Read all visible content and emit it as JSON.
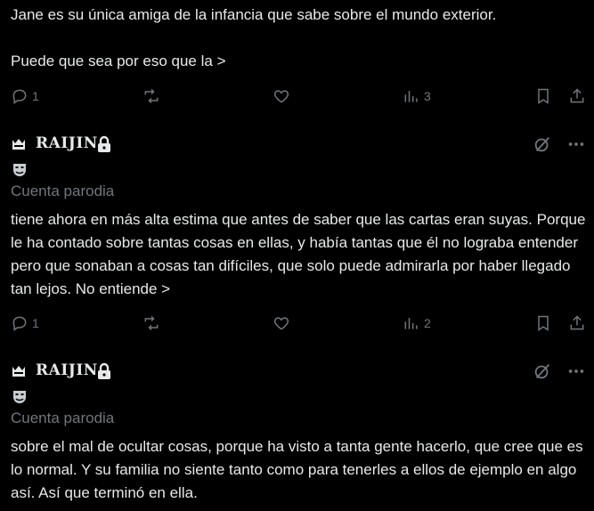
{
  "posts": [
    {
      "text": "Jane es su única amiga de la infancia que sabe sobre el mundo exterior.\n\nPuede que sea por eso que la >",
      "actions": {
        "replies": "1",
        "reposts": "",
        "likes": "",
        "views": "3"
      }
    },
    {
      "author": {
        "name": "RAIJIN.",
        "label": "Cuenta parodia"
      },
      "text": "tiene ahora en más alta estima que antes de saber que las cartas eran suyas. Porque le ha contado sobre tantas cosas en ellas, y había tantas que él no lograba entender pero que sonaban a cosas tan difíciles, que solo puede admirarla por haber llegado tan lejos. No entiende >",
      "actions": {
        "replies": "1",
        "reposts": "",
        "likes": "",
        "views": "2"
      }
    },
    {
      "author": {
        "name": "RAIJIN.",
        "label": "Cuenta parodia"
      },
      "text": "sobre el mal de ocultar cosas, porque ha visto a tanta gente hacerlo, que cree que es lo normal. Y su familia no siente tanto como para tenerles a ellos de ejemplo en algo así. Así que terminó en ella."
    }
  ],
  "icons": {
    "reply": "reply-icon",
    "repost": "repost-icon",
    "like": "heart-icon",
    "views": "views-icon",
    "bookmark": "bookmark-icon",
    "share": "share-icon",
    "crown": "crown-icon",
    "lock": "lock-icon",
    "mask": "theater-mask-icon",
    "grok": "grok-icon",
    "more": "more-icon"
  },
  "colors": {
    "background": "#000000",
    "text": "#e7e9ea",
    "muted": "#71767b"
  }
}
